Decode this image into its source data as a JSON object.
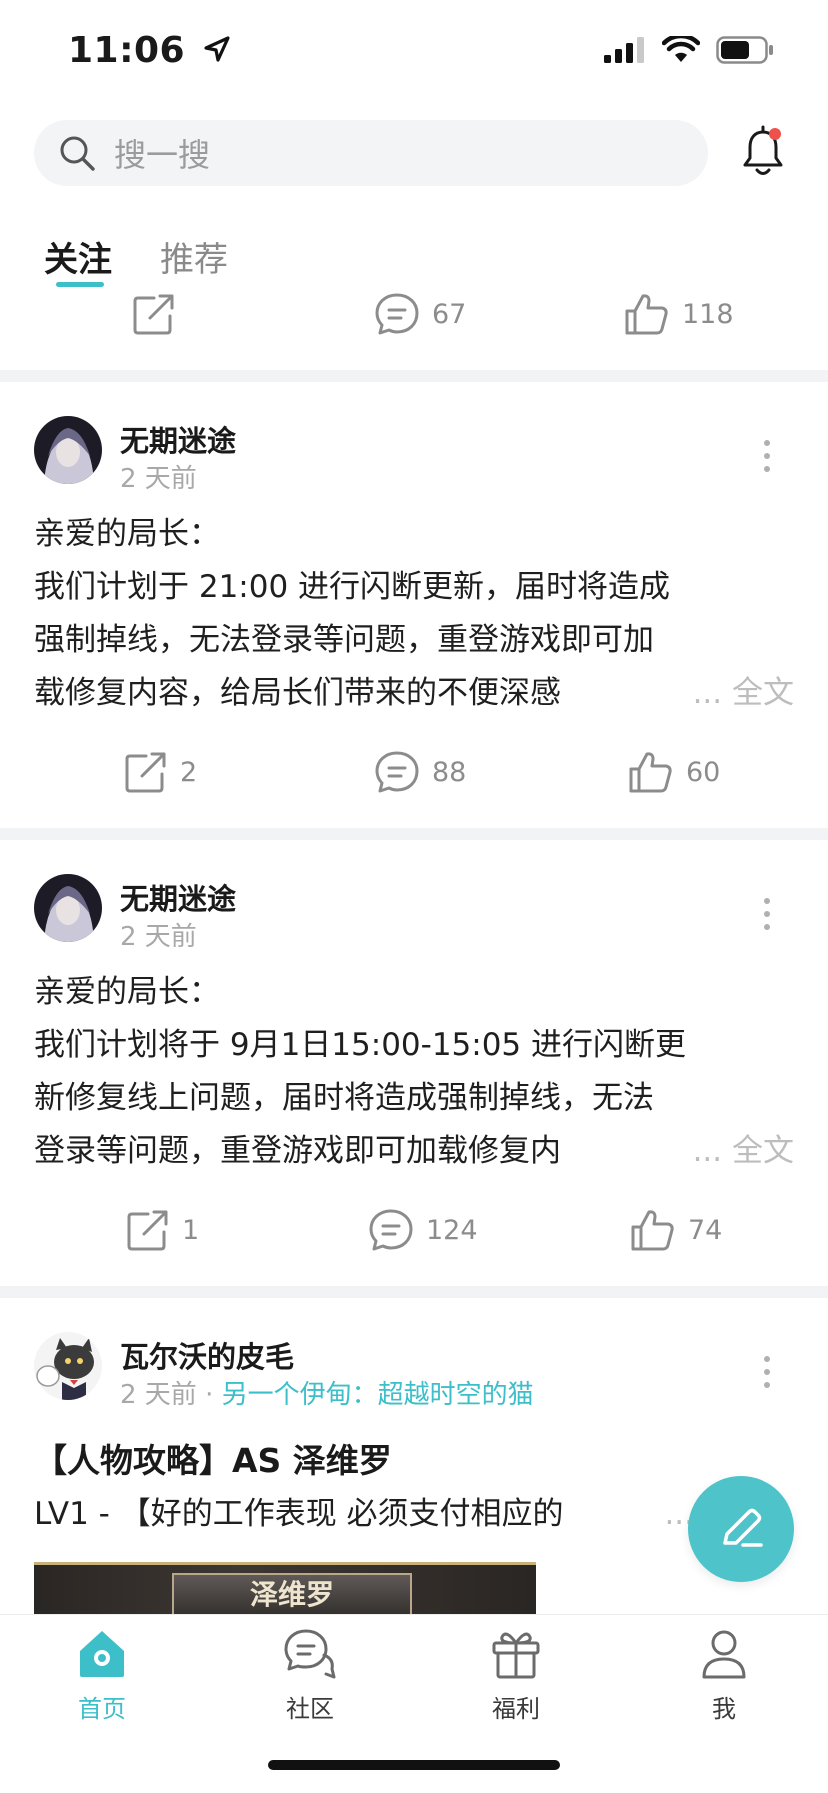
{
  "status_bar": {
    "time": "11:06"
  },
  "search": {
    "placeholder": "搜一搜"
  },
  "tabs": [
    {
      "label": "关注",
      "active": true
    },
    {
      "label": "推荐",
      "active": false
    }
  ],
  "top_actions": {
    "comments": "67",
    "likes": "118"
  },
  "posts": [
    {
      "author": "无期迷途",
      "time": "2 天前",
      "lines": [
        "亲爱的局长：",
        "我们计划于 21:00 进行闪断更新，届时将造成",
        "强制掉线，无法登录等问题，重登游戏即可加",
        "载修复内容，给局长们带来的不便深感"
      ],
      "more": "... 全文",
      "shares": "2",
      "comments": "88",
      "likes": "60"
    },
    {
      "author": "无期迷途",
      "time": "2 天前",
      "lines": [
        "亲爱的局长：",
        "我们计划将于 9月1日15:00-15:05 进行闪断更",
        "新修复线上问题，届时将造成强制掉线，无法",
        "登录等问题，重登游戏即可加载修复内"
      ],
      "more": "... 全文",
      "shares": "1",
      "comments": "124",
      "likes": "74"
    },
    {
      "author": "瓦尔沃的皮毛",
      "time": "2 天前",
      "separator": "·",
      "circle": "另一个伊甸：超越时空的猫",
      "title": "【人物攻略】AS 泽维罗",
      "preview": "LV1 - 【好的工作表现 必须支付相应的",
      "preview_more": "...",
      "image_label": "泽维罗"
    }
  ],
  "bottom_nav": [
    {
      "label": "首页",
      "icon": "home-icon",
      "active": true
    },
    {
      "label": "社区",
      "icon": "community-icon",
      "active": false
    },
    {
      "label": "福利",
      "icon": "gift-icon",
      "active": false
    },
    {
      "label": "我",
      "icon": "profile-icon",
      "active": false
    }
  ],
  "colors": {
    "accent": "#3dbfca",
    "fab": "#4ec3c9",
    "divider": "#f2f3f5"
  }
}
